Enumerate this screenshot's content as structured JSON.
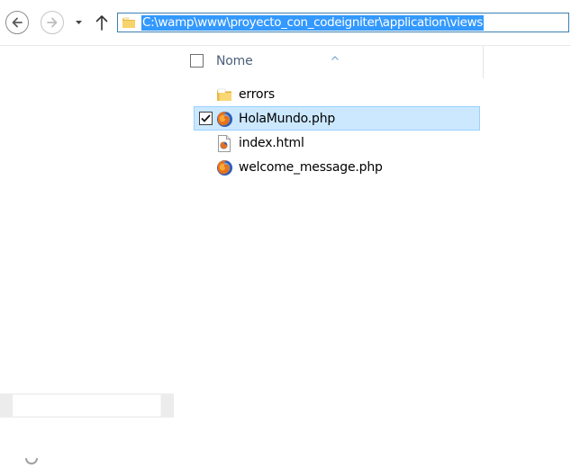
{
  "toolbar": {
    "icons": {
      "back": "back-arrow-icon",
      "forward": "forward-arrow-icon",
      "recent": "chevron-down-icon",
      "up": "up-arrow-icon"
    },
    "address": {
      "path": "C:\\wamp\\www\\proyecto_con_codeigniter\\application\\views",
      "icon": "folder-icon"
    }
  },
  "column_header": {
    "name_label": "Nome",
    "sort": "ascending"
  },
  "files": [
    {
      "name": "errors",
      "icon": "folder-icon",
      "selected": false
    },
    {
      "name": "HolaMundo.php",
      "icon": "firefox-icon",
      "selected": true
    },
    {
      "name": "index.html",
      "icon": "html-file-icon",
      "selected": false
    },
    {
      "name": "welcome_message.php",
      "icon": "firefox-icon",
      "selected": false
    }
  ],
  "colors": {
    "selection_bg": "#cce8ff",
    "selection_border": "#99d1ff",
    "address_highlight": "#3399ff",
    "address_border": "#3c7fb1",
    "header_text": "#4c607a"
  }
}
